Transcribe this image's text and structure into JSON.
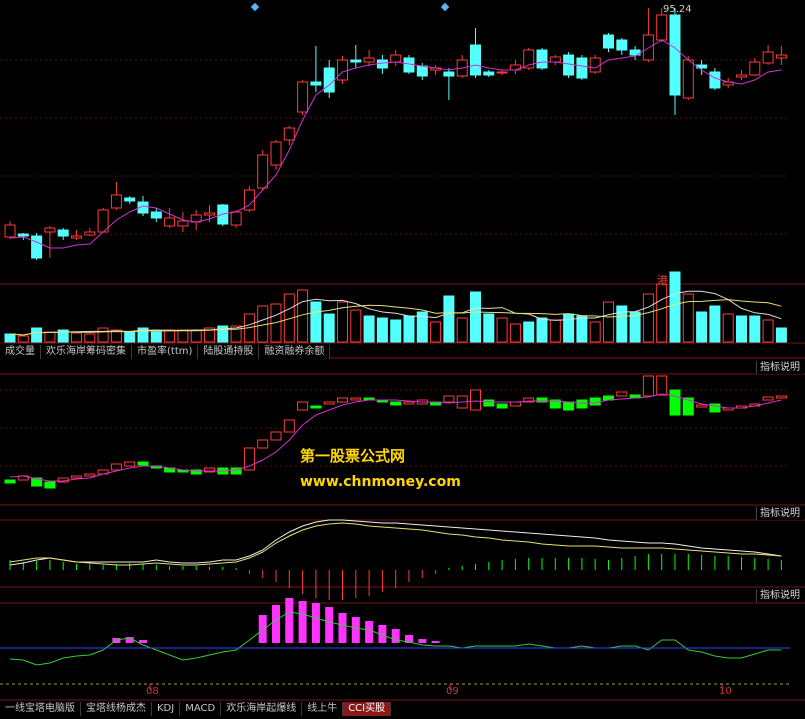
{
  "colors": {
    "up": "#ff3b3b",
    "down": "#54ffff",
    "ma": "#d033d0",
    "pink": "#ff33ff",
    "green": "#00ff00"
  },
  "top_chart": {
    "price_label": "95.24",
    "candles": [
      [
        225,
        237,
        221,
        239,
        "u"
      ],
      [
        236,
        234,
        233,
        240,
        "d"
      ],
      [
        236,
        258,
        233,
        260,
        "d"
      ],
      [
        232,
        228,
        226,
        258,
        "u"
      ],
      [
        230,
        236,
        228,
        240,
        "d"
      ],
      [
        238,
        236,
        230,
        240,
        "u"
      ],
      [
        235,
        232,
        228,
        236,
        "u"
      ],
      [
        232,
        210,
        208,
        226,
        "u"
      ],
      [
        208,
        195,
        182,
        210,
        "u"
      ],
      [
        198,
        201,
        196,
        204,
        "d"
      ],
      [
        202,
        213,
        196,
        216,
        "d"
      ],
      [
        212,
        218,
        208,
        222,
        "d"
      ],
      [
        218,
        226,
        208,
        228,
        "u"
      ],
      [
        226,
        221,
        212,
        232,
        "u"
      ],
      [
        222,
        215,
        210,
        230,
        "u"
      ],
      [
        213,
        215,
        205,
        222,
        "u"
      ],
      [
        205,
        224,
        204,
        226,
        "d"
      ],
      [
        225,
        212,
        210,
        228,
        "u"
      ],
      [
        210,
        190,
        186,
        212,
        "u"
      ],
      [
        188,
        155,
        150,
        190,
        "u"
      ],
      [
        165,
        142,
        140,
        170,
        "u"
      ],
      [
        140,
        128,
        126,
        145,
        "u"
      ],
      [
        112,
        82,
        80,
        115,
        "u"
      ],
      [
        85,
        82,
        46,
        92,
        "d"
      ],
      [
        68,
        92,
        60,
        98,
        "d"
      ],
      [
        80,
        60,
        56,
        84,
        "u"
      ],
      [
        60,
        62,
        45,
        68,
        "d"
      ],
      [
        62,
        58,
        50,
        66,
        "u"
      ],
      [
        60,
        68,
        55,
        74,
        "d"
      ],
      [
        62,
        55,
        50,
        66,
        "u"
      ],
      [
        58,
        72,
        55,
        74,
        "d"
      ],
      [
        66,
        76,
        63,
        80,
        "d"
      ],
      [
        70,
        68,
        65,
        75,
        "u"
      ],
      [
        72,
        76,
        68,
        100,
        "d"
      ],
      [
        76,
        60,
        55,
        78,
        "u"
      ],
      [
        45,
        75,
        28,
        78,
        "d"
      ],
      [
        75,
        72,
        70,
        77,
        "d"
      ],
      [
        73,
        72,
        70,
        75,
        "u"
      ],
      [
        70,
        65,
        60,
        74,
        "u"
      ],
      [
        68,
        50,
        48,
        70,
        "u"
      ],
      [
        50,
        68,
        48,
        70,
        "d"
      ],
      [
        62,
        57,
        55,
        65,
        "u"
      ],
      [
        55,
        75,
        52,
        78,
        "d"
      ],
      [
        58,
        78,
        55,
        80,
        "d"
      ],
      [
        72,
        58,
        55,
        74,
        "u"
      ],
      [
        35,
        48,
        33,
        52,
        "d"
      ],
      [
        50,
        40,
        38,
        55,
        "d"
      ],
      [
        50,
        55,
        46,
        60,
        "d"
      ],
      [
        60,
        35,
        8,
        62,
        "u"
      ],
      [
        40,
        15,
        8,
        42,
        "u"
      ],
      [
        15,
        95,
        8,
        115,
        "d"
      ],
      [
        98,
        60,
        56,
        100,
        "u"
      ],
      [
        65,
        68,
        60,
        75,
        "d"
      ],
      [
        72,
        88,
        68,
        90,
        "d"
      ],
      [
        85,
        82,
        78,
        88,
        "u"
      ],
      [
        77,
        75,
        70,
        80,
        "u"
      ],
      [
        75,
        62,
        58,
        76,
        "u"
      ],
      [
        63,
        52,
        45,
        65,
        "u"
      ],
      [
        58,
        55,
        46,
        65,
        "u"
      ]
    ],
    "ma": [
      238,
      237,
      242,
      248,
      248,
      245,
      244,
      232,
      220,
      212,
      206,
      208,
      214,
      220,
      222,
      219,
      214,
      212,
      205,
      190,
      175,
      150,
      120,
      95,
      85,
      72,
      68,
      65,
      63,
      62,
      64,
      66,
      68,
      70,
      68,
      65,
      68,
      70,
      70,
      65,
      62,
      62,
      64,
      66,
      68,
      60,
      58,
      56,
      48,
      40,
      48,
      60,
      70,
      78,
      82,
      84,
      80,
      72,
      70
    ]
  },
  "volume": {
    "bars": [
      [
        8,
        "d"
      ],
      [
        6,
        "u"
      ],
      [
        14,
        "d"
      ],
      [
        10,
        "u"
      ],
      [
        12,
        "d"
      ],
      [
        9,
        "u"
      ],
      [
        8,
        "u"
      ],
      [
        14,
        "u"
      ],
      [
        12,
        "u"
      ],
      [
        10,
        "d"
      ],
      [
        14,
        "d"
      ],
      [
        10,
        "d"
      ],
      [
        12,
        "u"
      ],
      [
        12,
        "u"
      ],
      [
        12,
        "u"
      ],
      [
        14,
        "u"
      ],
      [
        16,
        "d"
      ],
      [
        16,
        "u"
      ],
      [
        28,
        "u"
      ],
      [
        36,
        "u"
      ],
      [
        38,
        "u"
      ],
      [
        48,
        "u"
      ],
      [
        52,
        "u"
      ],
      [
        40,
        "d"
      ],
      [
        28,
        "d"
      ],
      [
        40,
        "u"
      ],
      [
        32,
        "u"
      ],
      [
        26,
        "d"
      ],
      [
        24,
        "d"
      ],
      [
        22,
        "d"
      ],
      [
        26,
        "d"
      ],
      [
        30,
        "d"
      ],
      [
        20,
        "u"
      ],
      [
        46,
        "d"
      ],
      [
        24,
        "u"
      ],
      [
        50,
        "d"
      ],
      [
        28,
        "d"
      ],
      [
        24,
        "u"
      ],
      [
        18,
        "u"
      ],
      [
        20,
        "d"
      ],
      [
        24,
        "d"
      ],
      [
        22,
        "u"
      ],
      [
        28,
        "d"
      ],
      [
        26,
        "d"
      ],
      [
        20,
        "u"
      ],
      [
        40,
        "u"
      ],
      [
        36,
        "d"
      ],
      [
        30,
        "d"
      ],
      [
        48,
        "u"
      ],
      [
        58,
        "u"
      ],
      [
        70,
        "d"
      ],
      [
        48,
        "u"
      ],
      [
        30,
        "d"
      ],
      [
        36,
        "d"
      ],
      [
        28,
        "u"
      ],
      [
        26,
        "d"
      ],
      [
        26,
        "d"
      ],
      [
        22,
        "u"
      ],
      [
        14,
        "d"
      ]
    ],
    "gang_label": "港"
  },
  "tabs_top": [
    "成交量",
    "欢乐海岸筹码密集",
    "市盈率(ttm)",
    "陆股通持股",
    "融资融券余额"
  ],
  "help_label": "指标说明",
  "watermark": {
    "line1": "第一股票公式网",
    "line2": "www.chnmoney.com"
  },
  "panel3": {
    "blocks": [
      [
        480,
        483,
        "d"
      ],
      [
        476,
        480,
        "u"
      ],
      [
        486,
        478,
        "d"
      ],
      [
        488,
        482,
        "d"
      ],
      [
        482,
        478,
        "u"
      ],
      [
        478,
        476,
        "u"
      ],
      [
        476,
        474,
        "u"
      ],
      [
        474,
        470,
        "u"
      ],
      [
        470,
        464,
        "u"
      ],
      [
        466,
        462,
        "u"
      ],
      [
        462,
        465,
        "d"
      ],
      [
        466,
        468,
        "d"
      ],
      [
        468,
        472,
        "d"
      ],
      [
        472,
        470,
        "d"
      ],
      [
        470,
        474,
        "d"
      ],
      [
        472,
        468,
        "u"
      ],
      [
        468,
        474,
        "d"
      ],
      [
        474,
        468,
        "d"
      ],
      [
        470,
        448,
        "u"
      ],
      [
        448,
        440,
        "u"
      ],
      [
        440,
        432,
        "u"
      ],
      [
        432,
        420,
        "u"
      ],
      [
        410,
        402,
        "u"
      ],
      [
        406,
        408,
        "d"
      ],
      [
        404,
        402,
        "u"
      ],
      [
        402,
        398,
        "u"
      ],
      [
        400,
        398,
        "u"
      ],
      [
        398,
        400,
        "d"
      ],
      [
        400,
        402,
        "d"
      ],
      [
        402,
        405,
        "d"
      ],
      [
        404,
        402,
        "u"
      ],
      [
        404,
        400,
        "u"
      ],
      [
        402,
        405,
        "d"
      ],
      [
        402,
        396,
        "u"
      ],
      [
        396,
        408,
        "u"
      ],
      [
        390,
        410,
        "u"
      ],
      [
        400,
        406,
        "d"
      ],
      [
        404,
        408,
        "d"
      ],
      [
        406,
        402,
        "u"
      ],
      [
        402,
        398,
        "u"
      ],
      [
        398,
        402,
        "d"
      ],
      [
        400,
        408,
        "d"
      ],
      [
        402,
        410,
        "d"
      ],
      [
        400,
        408,
        "d"
      ],
      [
        398,
        405,
        "d"
      ],
      [
        396,
        400,
        "d"
      ],
      [
        392,
        396,
        "u"
      ],
      [
        398,
        395,
        "d"
      ],
      [
        376,
        396,
        "u"
      ],
      [
        376,
        395,
        "u"
      ],
      [
        390,
        415,
        "d"
      ],
      [
        398,
        415,
        "d"
      ],
      [
        406,
        405,
        "u"
      ],
      [
        404,
        412,
        "d"
      ],
      [
        410,
        408,
        "u"
      ],
      [
        408,
        406,
        "u"
      ],
      [
        406,
        404,
        "u"
      ],
      [
        400,
        397,
        "u"
      ],
      [
        398,
        396,
        "u"
      ]
    ],
    "ma": [
      477,
      476,
      479,
      481,
      481,
      479,
      478,
      474,
      471,
      468,
      466,
      466,
      468,
      470,
      471,
      471,
      471,
      470,
      466,
      460,
      452,
      440,
      425,
      415,
      410,
      405,
      402,
      400,
      400,
      400,
      401,
      402,
      402,
      403,
      402,
      401,
      402,
      402,
      402,
      401,
      401,
      401,
      402,
      403,
      403,
      400,
      399,
      398,
      397,
      394,
      396,
      400,
      404,
      406,
      408,
      408,
      406,
      403,
      400
    ]
  },
  "panel4": {
    "line1": [
      565,
      563,
      560,
      558,
      560,
      562,
      562,
      562,
      562,
      562,
      562,
      560,
      562,
      563,
      563,
      562,
      560,
      560,
      556,
      550,
      540,
      532,
      526,
      522,
      520,
      520,
      521,
      522,
      523,
      523,
      524,
      525,
      526,
      527,
      528,
      529,
      530,
      531,
      532,
      533,
      534,
      535,
      536,
      537,
      538,
      540,
      541,
      542,
      543,
      543,
      544,
      546,
      548,
      549,
      550,
      551,
      552,
      554,
      556
    ],
    "line2": [
      562,
      560,
      558,
      558,
      560,
      562,
      563,
      564,
      565,
      565,
      564,
      563,
      564,
      565,
      565,
      564,
      563,
      562,
      558,
      552,
      543,
      536,
      530,
      526,
      524,
      523,
      524,
      526,
      527,
      528,
      529,
      530,
      532,
      534,
      535,
      537,
      538,
      540,
      541,
      542,
      544,
      545,
      546,
      546,
      546,
      547,
      548,
      548,
      548,
      548,
      549,
      550,
      551,
      552,
      553,
      554,
      554,
      555,
      556
    ],
    "hist": [
      10,
      8,
      9,
      10,
      8,
      6,
      6,
      5,
      6,
      7,
      6,
      5,
      4,
      4,
      4,
      3,
      3,
      2,
      -4,
      -8,
      -12,
      -18,
      -24,
      -28,
      -30,
      -30,
      -28,
      -26,
      -22,
      -18,
      -12,
      -8,
      -4,
      2,
      4,
      6,
      8,
      10,
      11,
      12,
      12,
      12,
      12,
      12,
      11,
      10,
      12,
      14,
      16,
      16,
      16,
      16,
      15,
      14,
      14,
      13,
      12,
      11,
      10
    ]
  },
  "panel5": {
    "bars": [
      0,
      0,
      0,
      0,
      0,
      0,
      0,
      0,
      5,
      6,
      3,
      0,
      0,
      0,
      0,
      0,
      0,
      0,
      0,
      28,
      38,
      45,
      42,
      40,
      36,
      30,
      26,
      22,
      18,
      14,
      8,
      4,
      2,
      0,
      0,
      0,
      0,
      0,
      0,
      0,
      0,
      0,
      0,
      0,
      0,
      0,
      0,
      0,
      0,
      0,
      0,
      0,
      0,
      0,
      0,
      0,
      0,
      0,
      0
    ],
    "cci": [
      659,
      660,
      665,
      663,
      658,
      656,
      655,
      650,
      640,
      638,
      645,
      650,
      655,
      660,
      658,
      655,
      652,
      650,
      640,
      630,
      620,
      612,
      614,
      618,
      622,
      625,
      628,
      630,
      635,
      640,
      642,
      645,
      646,
      646,
      648,
      646,
      646,
      646,
      646,
      644,
      646,
      648,
      648,
      646,
      648,
      648,
      646,
      646,
      650,
      640,
      640,
      650,
      652,
      656,
      658,
      658,
      654,
      650,
      650
    ]
  },
  "months": [
    "08",
    "09",
    "10"
  ],
  "tabs_bottom": [
    "一线宝塔电脑版",
    "宝塔线杨成杰",
    "KDJ",
    "MACD",
    "欢乐海岸起爆线",
    "线上牛",
    "CCI买股"
  ]
}
